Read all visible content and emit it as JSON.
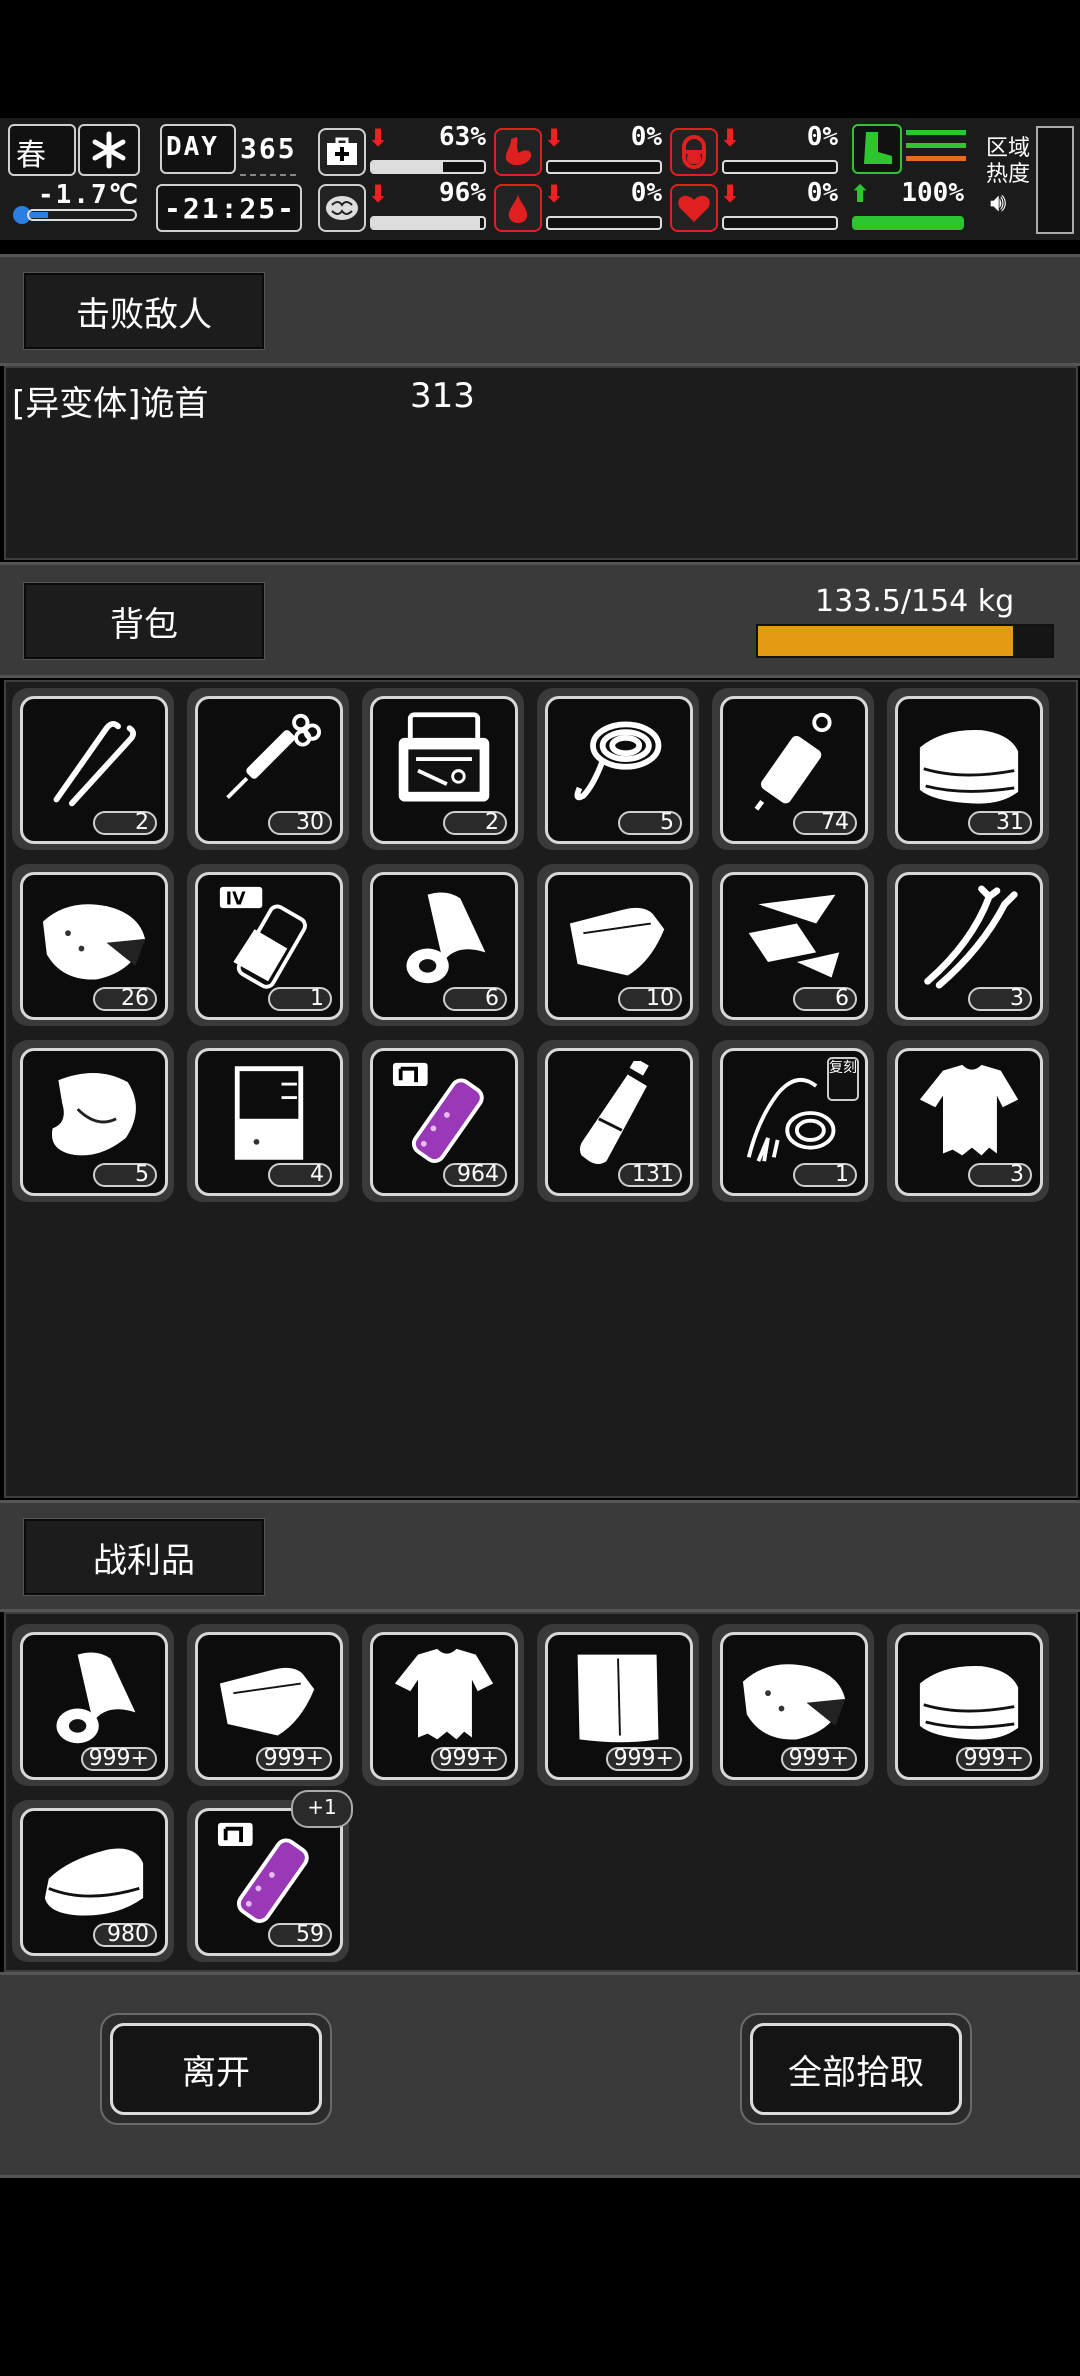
{
  "status_bar": {
    "season": "春",
    "temperature": "-1.7℃",
    "day_label": "DAY",
    "day_number": "365",
    "time": "-21:25-",
    "zone_heat_label": "区域\n热度",
    "stats": [
      {
        "name": "health",
        "value": "63%",
        "trend": "down",
        "fill": 0.63
      },
      {
        "name": "hunger",
        "value": "0%",
        "trend": "down",
        "fill": 0.0
      },
      {
        "name": "stamina-pill",
        "value": "0%",
        "trend": "down",
        "fill": 0.0
      },
      {
        "name": "mind",
        "value": "96%",
        "trend": "down",
        "fill": 0.96
      },
      {
        "name": "thirst",
        "value": "0%",
        "trend": "down",
        "fill": 0.0
      },
      {
        "name": "heart",
        "value": "0%",
        "trend": "down",
        "fill": 0.0
      },
      {
        "name": "speed",
        "value": "100%",
        "trend": "up",
        "fill": 1.0
      }
    ],
    "colors": {
      "thirst": "#e02020",
      "health_arrow": "#e02020",
      "speed": "#2ec62e",
      "heat_orange": "#e07020"
    }
  },
  "defeated": {
    "tab_label": "击败敌人",
    "entries": [
      {
        "name": "[异变体]诡首",
        "count": "313"
      }
    ]
  },
  "backpack": {
    "tab_label": "背包",
    "weight_text": "133.5/154 kg",
    "weight_fraction": 0.867,
    "items": [
      {
        "icon": "tweezers-icon",
        "qty": "2"
      },
      {
        "icon": "syringe-icon",
        "qty": "30"
      },
      {
        "icon": "surgical-kit-icon",
        "qty": "2"
      },
      {
        "icon": "rope-icon",
        "qty": "5"
      },
      {
        "icon": "injector-icon",
        "qty": "74"
      },
      {
        "icon": "folded-cloth-icon",
        "qty": "31"
      },
      {
        "icon": "raw-meat-icon",
        "qty": "26"
      },
      {
        "icon": "iv-bottle-icon",
        "qty": "1"
      },
      {
        "icon": "bandage-roll-icon",
        "qty": "6"
      },
      {
        "icon": "fabric-icon",
        "qty": "10"
      },
      {
        "icon": "scrap-icon",
        "qty": "6"
      },
      {
        "icon": "wire-icon",
        "qty": "3"
      },
      {
        "icon": "cooked-meat-icon",
        "qty": "5"
      },
      {
        "icon": "beaker-icon",
        "qty": "4"
      },
      {
        "icon": "purple-potion-icon",
        "qty": "964"
      },
      {
        "icon": "bottle-icon",
        "qty": "131"
      },
      {
        "icon": "whip-icon",
        "qty": "1",
        "tag": "复刻"
      },
      {
        "icon": "torn-shirt-icon",
        "qty": "3"
      }
    ]
  },
  "loot": {
    "tab_label": "战利品",
    "items": [
      {
        "icon": "bandage-roll-icon",
        "qty": "999+"
      },
      {
        "icon": "fabric-icon",
        "qty": "999+"
      },
      {
        "icon": "torn-shirt-icon",
        "qty": "999+"
      },
      {
        "icon": "cloth-sheet-icon",
        "qty": "999+"
      },
      {
        "icon": "raw-meat-icon",
        "qty": "999+"
      },
      {
        "icon": "folded-cloth-icon",
        "qty": "999+"
      },
      {
        "icon": "towel-icon",
        "qty": "980"
      },
      {
        "icon": "purple-potion-icon",
        "qty": "59",
        "badge": "+1"
      }
    ]
  },
  "actions": {
    "leave": "离开",
    "pickup_all": "全部拾取"
  }
}
